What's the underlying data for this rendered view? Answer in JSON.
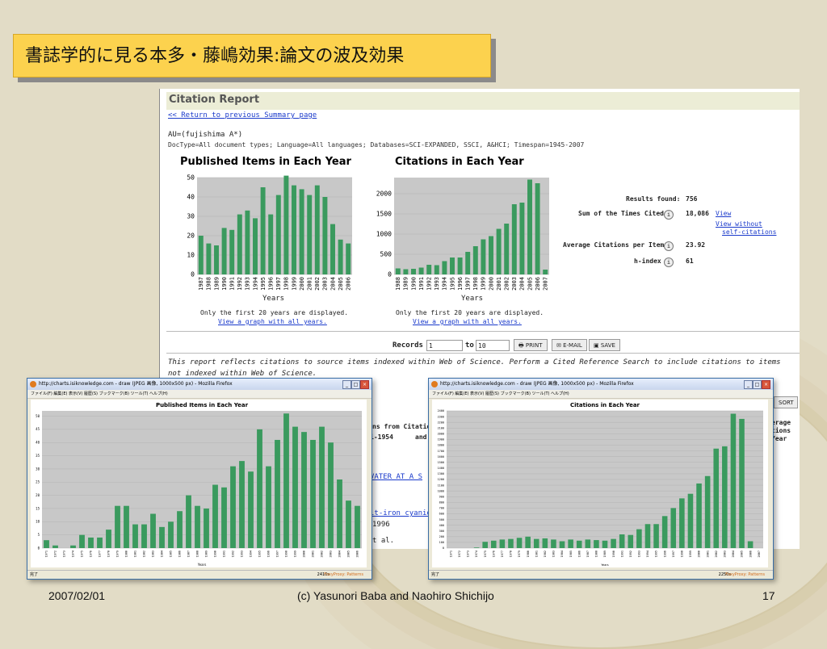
{
  "slide": {
    "title": "書誌学的に見る本多・藤嶋効果:論文の波及効果",
    "footer_date": "2007/02/01",
    "footer_credit": "(c) Yasunori Baba and Naohiro Shichijo",
    "footer_page": "17"
  },
  "report": {
    "header": "Citation Report",
    "back_link": "<< Return to previous Summary page",
    "query": "AU=(fujishima A*)",
    "filters": "DocType=All document types; Language=All languages; Databases=SCI-EXPANDED, SSCI, A&HCI; Timespan=1945-2007",
    "chart1_title": "Published Items in Each Year",
    "chart2_title": "Citations in Each Year",
    "x_label": "Years",
    "note": "Only the first 20 years are displayed.",
    "view_all_link": "View a graph with all years.",
    "stats": {
      "results_label": "Results found:",
      "results_value": "756",
      "sum_label": "Sum of the Times Cited",
      "sum_value": "18,086",
      "view_link": "View",
      "view_without_1": "View without",
      "view_without_2": "self-citations",
      "avg_label": "Average Citations per Item",
      "avg_value": "23.92",
      "h_label": "h-index",
      "h_value": "61",
      "info_glyph": "i"
    },
    "records_label": "Records",
    "records_from": "1",
    "records_to_label": "to",
    "records_to": "10",
    "print_label": "PRINT",
    "email_label": "E-MAIL",
    "save_label": "SAVE",
    "disclaimer": "This report reflects citations to source items indexed within Web of Science. Perform a Cited Reference Search to include citations to items not indexed within Web of Science.",
    "sort_label": "SORT",
    "partial": {
      "p1": "ns from Citation",
      "p2": "i-1954",
      "p3": "and",
      "p4": "VATER AT A S",
      "p5": "lt-iron cyanid",
      "p6": "1996",
      "p7": "t al.",
      "p8": "erage",
      "p9": "tions",
      "p10": "Year"
    }
  },
  "windows": {
    "w1_titlebar": "http://charts.isiknowledge.com - draw (JPEG 画像, 1000x500 px) - Mozilla Firefox",
    "w2_titlebar": "http://charts.isiknowledge.com - draw (JPEG 画像, 1000x500 px) - Mozilla Firefox",
    "menu": "ファイル(F)   編集(E)   表示(V)   履歴(S)   ブックマーク(B)   ツール(T)   ヘルプ(H)",
    "status_left": "完了",
    "status_right1": "2410s",
    "status_right2": "2250s",
    "status_brand": "FoxyProxy: Patterns",
    "w1_title": "Published Items in Each Year",
    "w2_title": "Citations in Each Year",
    "x_label": "Years"
  },
  "chart_data": [
    {
      "type": "bar",
      "title": "Published Items in Each Year",
      "xlabel": "Years",
      "ylabel": "",
      "ylim": [
        0,
        50
      ],
      "yticks": [
        0,
        10,
        20,
        30,
        40,
        50
      ],
      "categories": [
        "1987",
        "1988",
        "1989",
        "1990",
        "1991",
        "1992",
        "1993",
        "1994",
        "1995",
        "1996",
        "1997",
        "1998",
        "1999",
        "2000",
        "2001",
        "2002",
        "2003",
        "2004",
        "2005",
        "2006"
      ],
      "values": [
        20,
        16,
        15,
        24,
        23,
        31,
        33,
        29,
        45,
        31,
        41,
        51,
        46,
        44,
        41,
        46,
        40,
        26,
        18,
        16
      ],
      "color": "#3a9a5e"
    },
    {
      "type": "bar",
      "title": "Citations in Each Year",
      "xlabel": "Years",
      "ylabel": "",
      "ylim": [
        0,
        2400
      ],
      "yticks": [
        0,
        500,
        1000,
        1500,
        2000
      ],
      "categories": [
        "1988",
        "1989",
        "1990",
        "1991",
        "1992",
        "1993",
        "1994",
        "1995",
        "1996",
        "1997",
        "1998",
        "1999",
        "2000",
        "2001",
        "2002",
        "2003",
        "2004",
        "2005",
        "2006",
        "2007"
      ],
      "values": [
        150,
        130,
        140,
        170,
        240,
        230,
        330,
        420,
        420,
        560,
        700,
        870,
        950,
        1130,
        1260,
        1740,
        1780,
        2350,
        2260,
        120
      ],
      "color": "#3a9a5e"
    },
    {
      "type": "bar",
      "title": "Published Items in Each Year",
      "xlabel": "Years",
      "ylim": [
        0,
        52
      ],
      "yticks": [
        0,
        5,
        10,
        15,
        20,
        25,
        30,
        35,
        40,
        45,
        50
      ],
      "categories": [
        "1971",
        "1972",
        "1973",
        "1974",
        "1975",
        "1976",
        "1977",
        "1978",
        "1979",
        "1980",
        "1981",
        "1982",
        "1983",
        "1984",
        "1985",
        "1986",
        "1987",
        "1988",
        "1989",
        "1990",
        "1991",
        "1992",
        "1993",
        "1994",
        "1995",
        "1996",
        "1997",
        "1998",
        "1999",
        "2000",
        "2001",
        "2002",
        "2003",
        "2004",
        "2005",
        "2006"
      ],
      "values": [
        3,
        1,
        0,
        1,
        5,
        4,
        4,
        7,
        16,
        16,
        9,
        9,
        13,
        8,
        10,
        14,
        20,
        16,
        15,
        24,
        23,
        31,
        33,
        29,
        45,
        31,
        41,
        51,
        46,
        44,
        41,
        46,
        40,
        26,
        18,
        16
      ],
      "color": "#3a9a5e"
    },
    {
      "type": "bar",
      "title": "Citations in Each Year",
      "xlabel": "Years",
      "ylim": [
        0,
        2400
      ],
      "yticks": [
        0,
        100,
        200,
        300,
        400,
        500,
        600,
        700,
        800,
        900,
        1000,
        1100,
        1200,
        1300,
        1400,
        1500,
        1600,
        1700,
        1800,
        1900,
        2000,
        2100,
        2200,
        2300,
        2400
      ],
      "categories": [
        "1971",
        "1972",
        "1973",
        "1974",
        "1975",
        "1976",
        "1977",
        "1978",
        "1979",
        "1980",
        "1981",
        "1982",
        "1983",
        "1984",
        "1985",
        "1986",
        "1987",
        "1988",
        "1989",
        "1990",
        "1991",
        "1992",
        "1993",
        "1994",
        "1995",
        "1996",
        "1997",
        "1998",
        "1999",
        "2000",
        "2001",
        "2002",
        "2003",
        "2004",
        "2005",
        "2006",
        "2007"
      ],
      "values": [
        0,
        0,
        0,
        10,
        110,
        130,
        150,
        160,
        180,
        200,
        160,
        170,
        150,
        120,
        150,
        130,
        150,
        140,
        130,
        160,
        240,
        230,
        330,
        420,
        420,
        560,
        700,
        870,
        950,
        1130,
        1260,
        1740,
        1780,
        2350,
        2260,
        120,
        0
      ],
      "color": "#3a9a5e"
    }
  ]
}
